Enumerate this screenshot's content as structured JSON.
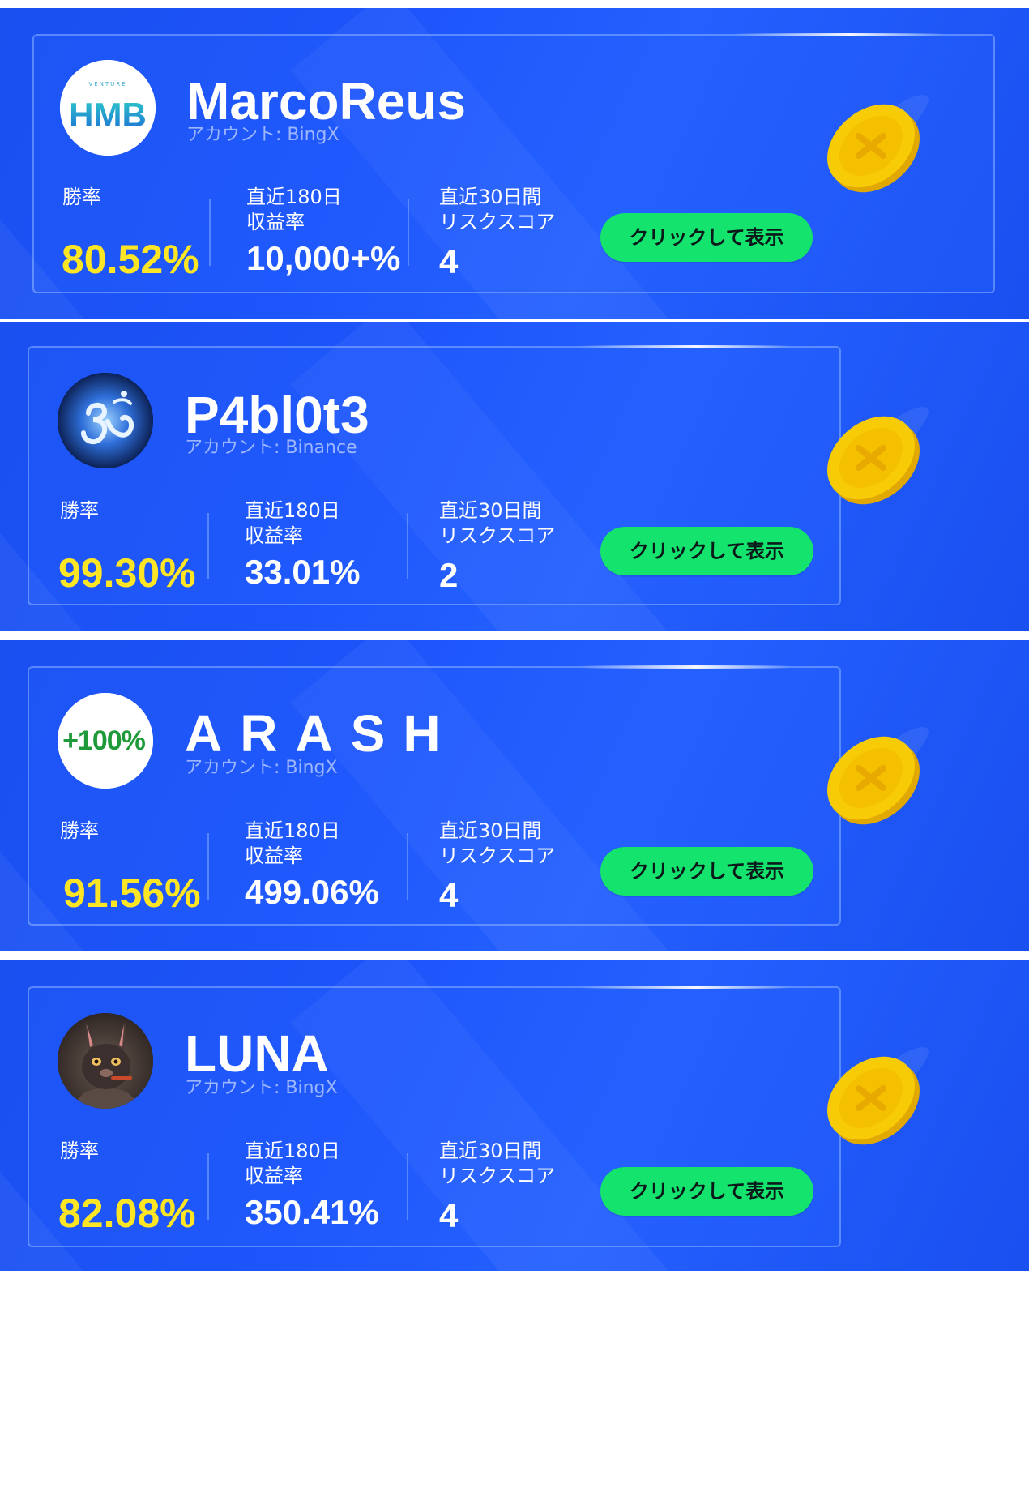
{
  "traders": [
    {
      "name": "MarcoReus",
      "account": "アカウント: BingX",
      "avatar_text": "HMB",
      "avatar_small_text": "VENTURE",
      "win_rate_label": "勝率",
      "profit_label_line1": "直近180日",
      "profit_label_line2": "収益率",
      "risk_label_line1": "直近30日間",
      "risk_label_line2": "リスクスコア",
      "win_rate": "80.52%",
      "profit_180d": "10,000+%",
      "risk_score": "4",
      "cta_label": "クリックして表示"
    },
    {
      "name": "P4bl0t3",
      "account": "アカウント: Binance",
      "avatar_text": "",
      "avatar_small_text": "",
      "win_rate_label": "勝率",
      "profit_label_line1": "直近180日",
      "profit_label_line2": "収益率",
      "risk_label_line1": "直近30日間",
      "risk_label_line2": "リスクスコア",
      "win_rate": "99.30%",
      "profit_180d": "33.01%",
      "risk_score": "2",
      "cta_label": "クリックして表示"
    },
    {
      "name": "ARASH",
      "account": "アカウント: BingX",
      "avatar_text": "+100%",
      "avatar_small_text": "",
      "win_rate_label": "勝率",
      "profit_label_line1": "直近180日",
      "profit_label_line2": "収益率",
      "risk_label_line1": "直近30日間",
      "risk_label_line2": "リスクスコア",
      "win_rate": "91.56%",
      "profit_180d": "499.06%",
      "risk_score": "4",
      "cta_label": "クリックして表示"
    },
    {
      "name": "LUNA",
      "account": "アカウント: BingX",
      "avatar_text": "",
      "avatar_small_text": "",
      "win_rate_label": "勝率",
      "profit_label_line1": "直近180日",
      "profit_label_line2": "収益率",
      "risk_label_line1": "直近30日間",
      "risk_label_line2": "リスクスコア",
      "win_rate": "82.08%",
      "profit_180d": "350.41%",
      "risk_score": "4",
      "cta_label": "クリックして表示"
    }
  ],
  "colors": {
    "panel_blue": "#1d55fb",
    "win_rate_yellow": "#ffe624",
    "cta_green": "#14e36e",
    "coin_gold": "#f5c400"
  },
  "icons": {
    "coin": "gold-coin-icon"
  }
}
